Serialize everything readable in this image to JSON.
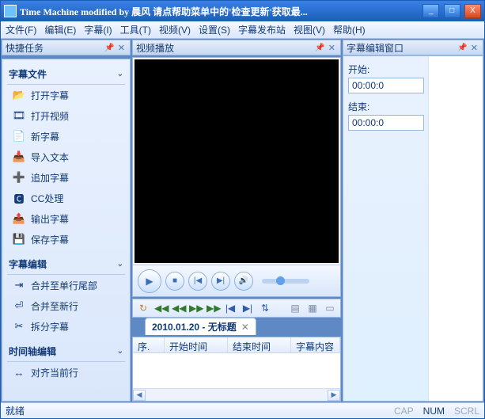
{
  "title": "Time Machine modified by 晨风 请点帮助菜单中的'检查更新'获取最...",
  "menu": [
    "文件(F)",
    "编辑(E)",
    "字幕(I)",
    "工具(T)",
    "视频(V)",
    "设置(S)",
    "字幕发布站",
    "视图(V)",
    "帮助(H)"
  ],
  "leftPanelTitle": "快捷任务",
  "sections": {
    "subtitleFiles": {
      "title": "字幕文件",
      "items": [
        "打开字幕",
        "打开视频",
        "新字幕",
        "导入文本",
        "追加字幕",
        "CC处理",
        "输出字幕",
        "保存字幕"
      ]
    },
    "subtitleEdit": {
      "title": "字幕编辑",
      "items": [
        "合并至单行尾部",
        "合并至新行",
        "拆分字幕"
      ]
    },
    "timelineEdit": {
      "title": "时间轴编辑",
      "items": [
        "对齐当前行"
      ]
    }
  },
  "videoPanelTitle": "视频播放",
  "tabLabel": "2010.01.20 - 无标题",
  "columns": [
    "序.",
    "开始时间",
    "结束时间",
    "字幕内容"
  ],
  "rightPanelTitle": "字幕编辑窗口",
  "startLabel": "开始:",
  "startValue": "00:00:0",
  "endLabel": "结束:",
  "endValue": "00:00:0",
  "status": "就绪",
  "indicators": {
    "cap": "CAP",
    "num": "NUM",
    "scrl": "SCRL"
  }
}
